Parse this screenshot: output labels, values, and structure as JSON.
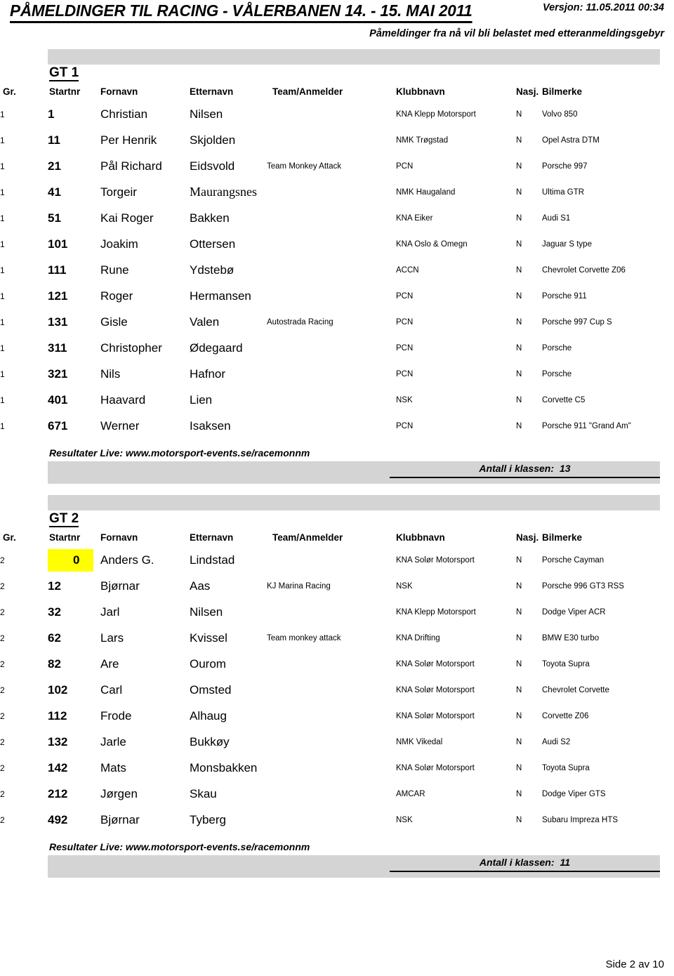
{
  "header": {
    "title": "PÅMELDINGER TIL RACING - VÅLERBANEN 14. - 15. MAI 2011",
    "version": "Versjon: 11.05.2011 00:34",
    "late_fee_notice": "Påmeldinger fra nå vil bli belastet med etteranmeldingsgebyr"
  },
  "columns": {
    "gr": "Gr.",
    "startnr": "Startnr",
    "fornavn": "Fornavn",
    "etternavn": "Etternavn",
    "team": "Team/Anmelder",
    "klubbnavn": "Klubbnavn",
    "nasj": "Nasj.",
    "bilmerke": "Bilmerke"
  },
  "classes": [
    {
      "name": "GT 1",
      "live_link": "Resultater Live: www.motorsport-events.se/racemonnm",
      "count_label": "Antall i klassen:",
      "count_value": "13",
      "rows": [
        {
          "gr": "1",
          "startnr": "1",
          "fornavn": "Christian",
          "etternavn": "Nilsen",
          "team": "",
          "klubb": "KNA Klepp Motorsport",
          "nasj": "N",
          "bil": "Volvo 850"
        },
        {
          "gr": "1",
          "startnr": "11",
          "fornavn": "Per Henrik",
          "etternavn": "Skjolden",
          "team": "",
          "klubb": "NMK Trøgstad",
          "nasj": "N",
          "bil": "Opel Astra DTM"
        },
        {
          "gr": "1",
          "startnr": "21",
          "fornavn": "Pål Richard",
          "etternavn": "Eidsvold",
          "team": "Team Monkey Attack",
          "klubb": "PCN",
          "nasj": "N",
          "bil": "Porsche 997"
        },
        {
          "gr": "1",
          "startnr": "41",
          "fornavn": "Torgeir",
          "etternavn": "Maurangsnes",
          "team": "",
          "klubb": "NMK Haugaland",
          "nasj": "N",
          "bil": "Ultima GTR",
          "serif": true
        },
        {
          "gr": "1",
          "startnr": "51",
          "fornavn": "Kai Roger",
          "etternavn": "Bakken",
          "team": "",
          "klubb": "KNA Eiker",
          "nasj": "N",
          "bil": "Audi S1"
        },
        {
          "gr": "1",
          "startnr": "101",
          "fornavn": "Joakim",
          "etternavn": "Ottersen",
          "team": "",
          "klubb": "KNA Oslo & Omegn",
          "nasj": "N",
          "bil": "Jaguar S type"
        },
        {
          "gr": "1",
          "startnr": "111",
          "fornavn": "Rune",
          "etternavn": "Ydstebø",
          "team": "",
          "klubb": "ACCN",
          "nasj": "N",
          "bil": "Chevrolet Corvette Z06"
        },
        {
          "gr": "1",
          "startnr": "121",
          "fornavn": "Roger",
          "etternavn": "Hermansen",
          "team": "",
          "klubb": "PCN",
          "nasj": "N",
          "bil": "Porsche 911"
        },
        {
          "gr": "1",
          "startnr": "131",
          "fornavn": "Gisle",
          "etternavn": "Valen",
          "team": "Autostrada Racing",
          "klubb": "PCN",
          "nasj": "N",
          "bil": "Porsche 997 Cup S"
        },
        {
          "gr": "1",
          "startnr": "311",
          "fornavn": "Christopher",
          "etternavn": "Ødegaard",
          "team": "",
          "klubb": "PCN",
          "nasj": "N",
          "bil": "Porsche"
        },
        {
          "gr": "1",
          "startnr": "321",
          "fornavn": "Nils",
          "etternavn": "Hafnor",
          "team": "",
          "klubb": "PCN",
          "nasj": "N",
          "bil": "Porsche"
        },
        {
          "gr": "1",
          "startnr": "401",
          "fornavn": "Haavard",
          "etternavn": "Lien",
          "team": "",
          "klubb": "NSK",
          "nasj": "N",
          "bil": "Corvette C5"
        },
        {
          "gr": "1",
          "startnr": "671",
          "fornavn": "Werner",
          "etternavn": "Isaksen",
          "team": "",
          "klubb": "PCN",
          "nasj": "N",
          "bil": "Porsche 911  \"Grand Am\""
        }
      ]
    },
    {
      "name": "GT 2",
      "live_link": "Resultater Live: www.motorsport-events.se/racemonnm",
      "count_label": "Antall i klassen:",
      "count_value": "11",
      "rows": [
        {
          "gr": "2",
          "startnr": "0",
          "fornavn": "Anders G.",
          "etternavn": "Lindstad",
          "team": "",
          "klubb": "KNA Solør Motorsport",
          "nasj": "N",
          "bil": "Porsche Cayman",
          "highlight": true
        },
        {
          "gr": "2",
          "startnr": "12",
          "fornavn": "Bjørnar",
          "etternavn": "Aas",
          "team": "KJ Marina Racing",
          "klubb": "NSK",
          "nasj": "N",
          "bil": "Porsche 996 GT3 RSS"
        },
        {
          "gr": "2",
          "startnr": "32",
          "fornavn": "Jarl",
          "etternavn": "Nilsen",
          "team": "",
          "klubb": "KNA Klepp Motorsport",
          "nasj": "N",
          "bil": "Dodge Viper ACR"
        },
        {
          "gr": "2",
          "startnr": "62",
          "fornavn": "Lars",
          "etternavn": "Kvissel",
          "team": "Team monkey attack",
          "klubb": "KNA Drifting",
          "nasj": "N",
          "bil": "BMW E30 turbo"
        },
        {
          "gr": "2",
          "startnr": "82",
          "fornavn": "Are",
          "etternavn": "Ourom",
          "team": "",
          "klubb": "KNA Solør Motorsport",
          "nasj": "N",
          "bil": "Toyota Supra"
        },
        {
          "gr": "2",
          "startnr": "102",
          "fornavn": "Carl",
          "etternavn": "Omsted",
          "team": "",
          "klubb": "KNA Solør Motorsport",
          "nasj": "N",
          "bil": "Chevrolet Corvette"
        },
        {
          "gr": "2",
          "startnr": "112",
          "fornavn": "Frode",
          "etternavn": "Alhaug",
          "team": "",
          "klubb": "KNA Solør Motorsport",
          "nasj": "N",
          "bil": "Corvette Z06"
        },
        {
          "gr": "2",
          "startnr": "132",
          "fornavn": "Jarle",
          "etternavn": "Bukkøy",
          "team": "",
          "klubb": "NMK Vikedal",
          "nasj": "N",
          "bil": "Audi S2"
        },
        {
          "gr": "2",
          "startnr": "142",
          "fornavn": "Mats",
          "etternavn": "Monsbakken",
          "team": "",
          "klubb": "KNA Solør Motorsport",
          "nasj": "N",
          "bil": "Toyota Supra"
        },
        {
          "gr": "2",
          "startnr": "212",
          "fornavn": "Jørgen",
          "etternavn": "Skau",
          "team": "",
          "klubb": "AMCAR",
          "nasj": "N",
          "bil": "Dodge Viper GTS"
        },
        {
          "gr": "2",
          "startnr": "492",
          "fornavn": "Bjørnar",
          "etternavn": "Tyberg",
          "team": "",
          "klubb": "NSK",
          "nasj": "N",
          "bil": "Subaru Impreza HTS"
        }
      ]
    }
  ],
  "footer": {
    "page_number": "Side 2 av 10"
  },
  "colors": {
    "band_gray": "#d4d4d4",
    "highlight_yellow": "#ffff00"
  }
}
